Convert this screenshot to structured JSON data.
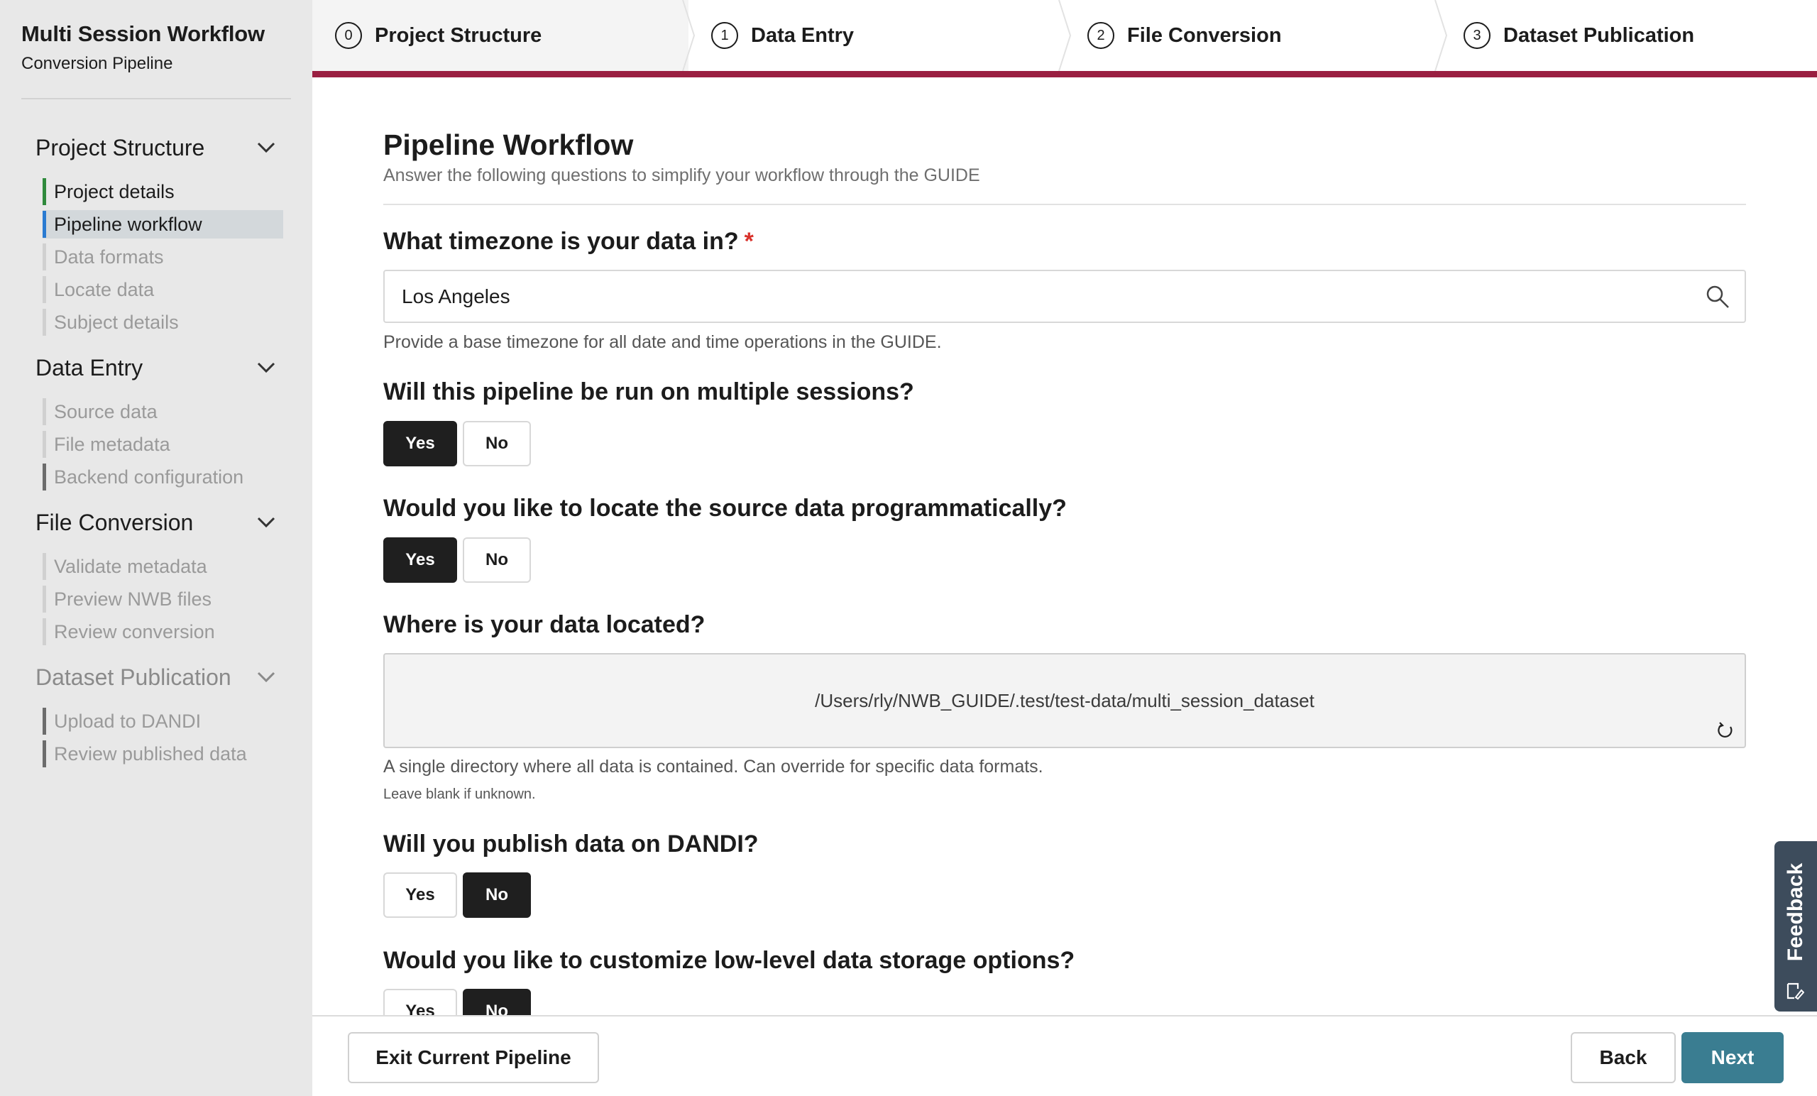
{
  "app": {
    "title": "Multi Session Workflow",
    "subtitle": "Conversion Pipeline"
  },
  "sidebar": {
    "sections": [
      {
        "label": "Project Structure",
        "items": [
          "Project details",
          "Pipeline workflow",
          "Data formats",
          "Locate data",
          "Subject details"
        ]
      },
      {
        "label": "Data Entry",
        "items": [
          "Source data",
          "File metadata",
          "Backend configuration"
        ]
      },
      {
        "label": "File Conversion",
        "items": [
          "Validate metadata",
          "Preview NWB files",
          "Review conversion"
        ]
      },
      {
        "label": "Dataset Publication",
        "items": [
          "Upload to DANDI",
          "Review published data"
        ]
      }
    ]
  },
  "stepper": {
    "steps": [
      {
        "number": "0",
        "label": "Project Structure"
      },
      {
        "number": "1",
        "label": "Data Entry"
      },
      {
        "number": "2",
        "label": "File Conversion"
      },
      {
        "number": "3",
        "label": "Dataset Publication"
      }
    ]
  },
  "page": {
    "title": "Pipeline Workflow",
    "subtitle": "Answer the following questions to simplify your workflow through the GUIDE"
  },
  "form": {
    "timezone": {
      "question": "What timezone is your data in?",
      "required_mark": "*",
      "value": "Los Angeles",
      "help": "Provide a base timezone for all date and time operations in the GUIDE."
    },
    "multiple_sessions": {
      "question": "Will this pipeline be run on multiple sessions?",
      "yes": "Yes",
      "no": "No",
      "selected": "Yes"
    },
    "locate_programmatically": {
      "question": "Would you like to locate the source data programmatically?",
      "yes": "Yes",
      "no": "No",
      "selected": "Yes"
    },
    "data_location": {
      "question": "Where is your data located?",
      "value": "/Users/rly/NWB_GUIDE/.test/test-data/multi_session_dataset",
      "help": "A single directory where all data is contained. Can override for specific data formats.",
      "help_small": "Leave blank if unknown."
    },
    "publish_dandi": {
      "question": "Will you publish data on DANDI?",
      "yes": "Yes",
      "no": "No",
      "selected": "No"
    },
    "storage_options": {
      "question": "Would you like to customize low-level data storage options?",
      "yes": "Yes",
      "no": "No",
      "selected": "No"
    }
  },
  "footer": {
    "exit_label": "Exit Current Pipeline",
    "back_label": "Back",
    "next_label": "Next"
  },
  "feedback": {
    "label": "Feedback"
  },
  "colors": {
    "progress_bar": "#9a1f41",
    "primary_button": "#3a7d91",
    "active_nav_bar": "#2a7bd1",
    "done_nav_bar": "#2f8a3c",
    "required": "#d9322b",
    "feedback_tab": "#3d4c5c"
  }
}
